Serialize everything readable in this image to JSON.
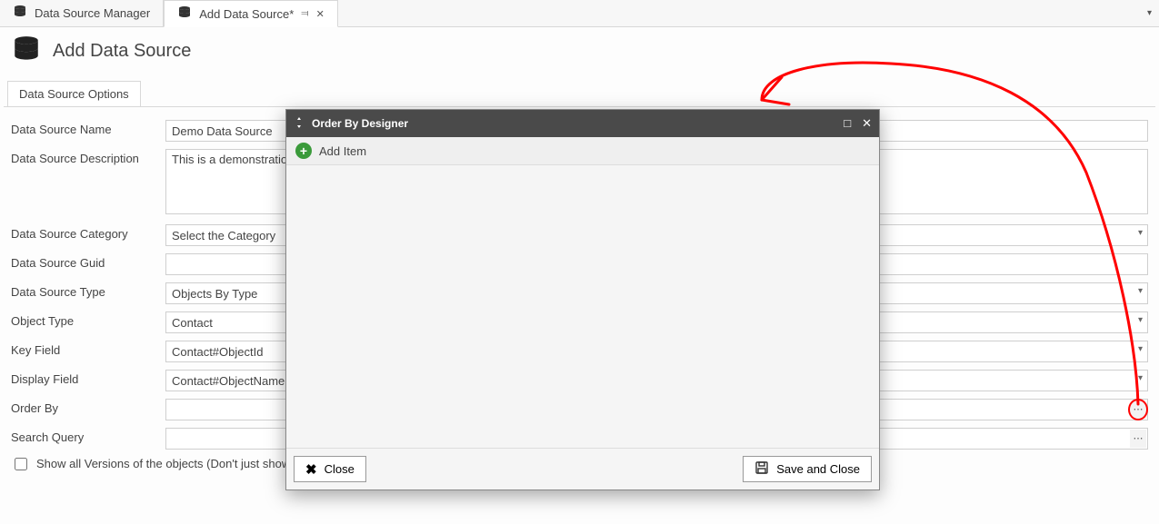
{
  "tabs": {
    "manager": "Data Source Manager",
    "add": "Add Data Source*"
  },
  "header": {
    "title": "Add Data Source"
  },
  "inner_tab": {
    "label": "Data Source Options"
  },
  "form": {
    "name_label": "Data Source Name",
    "name_value": "Demo Data Source",
    "desc_label": "Data Source Description",
    "desc_value": "This is a demonstration data source.",
    "category_label": "Data Source Category",
    "category_value": "Select the Category",
    "guid_label": "Data Source Guid",
    "guid_value": "",
    "type_label": "Data Source Type",
    "type_value": "Objects By Type",
    "object_type_label": "Object Type",
    "object_type_value": "Contact",
    "key_field_label": "Key Field",
    "key_field_value": "Contact#ObjectId",
    "display_field_label": "Display Field",
    "display_field_value": "Contact#ObjectName",
    "orderby_label": "Order By",
    "orderby_value": "",
    "search_label": "Search Query",
    "search_value": "",
    "checkbox_label": "Show all Versions of the objects (Don't just show the latest)"
  },
  "modal": {
    "title": "Order By Designer",
    "add_item": "Add Item",
    "close": "Close",
    "save": "Save and Close"
  }
}
